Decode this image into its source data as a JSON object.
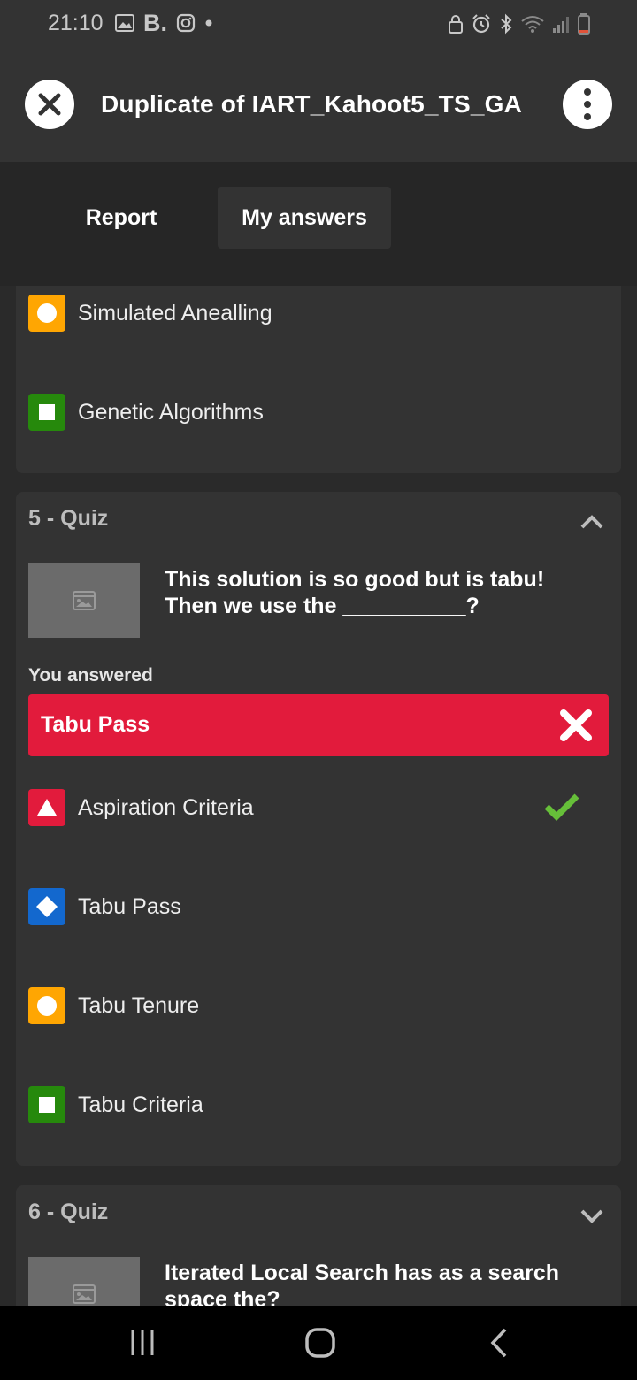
{
  "status_bar": {
    "time": "21:10",
    "b_label": "B.",
    "icons_left": [
      "gallery-icon",
      "b-app-icon",
      "instagram-icon",
      "dot-icon"
    ],
    "icons_right": [
      "lock-icon",
      "alarm-icon",
      "bluetooth-icon",
      "wifi-icon",
      "signal-icon",
      "battery-low-icon"
    ]
  },
  "header": {
    "title": "Duplicate of IART_Kahoot5_TS_GA"
  },
  "tabs": [
    {
      "label": "Report",
      "active": false
    },
    {
      "label": "My answers",
      "active": true
    }
  ],
  "prev_card": {
    "answers": [
      {
        "shape": "circle",
        "color": "#ffa602",
        "label": "Simulated Anealling"
      },
      {
        "shape": "square",
        "color": "#26890c",
        "label": "Genetic Algorithms"
      }
    ]
  },
  "question_5": {
    "heading": "5 - Quiz",
    "expanded": true,
    "question_line1": "This solution is so good but is tabu!",
    "question_line2": "Then we use the __________?",
    "you_answered_label": "You answered",
    "your_answer": "Tabu Pass",
    "your_answer_correct": false,
    "answers": [
      {
        "shape": "triangle",
        "color": "#e21b3c",
        "label": "Aspiration Criteria",
        "correct": true
      },
      {
        "shape": "diamond",
        "color": "#1368ce",
        "label": "Tabu Pass",
        "correct": false
      },
      {
        "shape": "circle",
        "color": "#ffa602",
        "label": "Tabu Tenure",
        "correct": false
      },
      {
        "shape": "square",
        "color": "#26890c",
        "label": "Tabu Criteria",
        "correct": false
      }
    ]
  },
  "question_6": {
    "heading": "6 - Quiz",
    "expanded": false,
    "question_line1": "Iterated Local Search has as a search",
    "question_line2": "space the?"
  },
  "colors": {
    "correct_check": "#66bf39",
    "wrong_red": "#e21b3c"
  }
}
